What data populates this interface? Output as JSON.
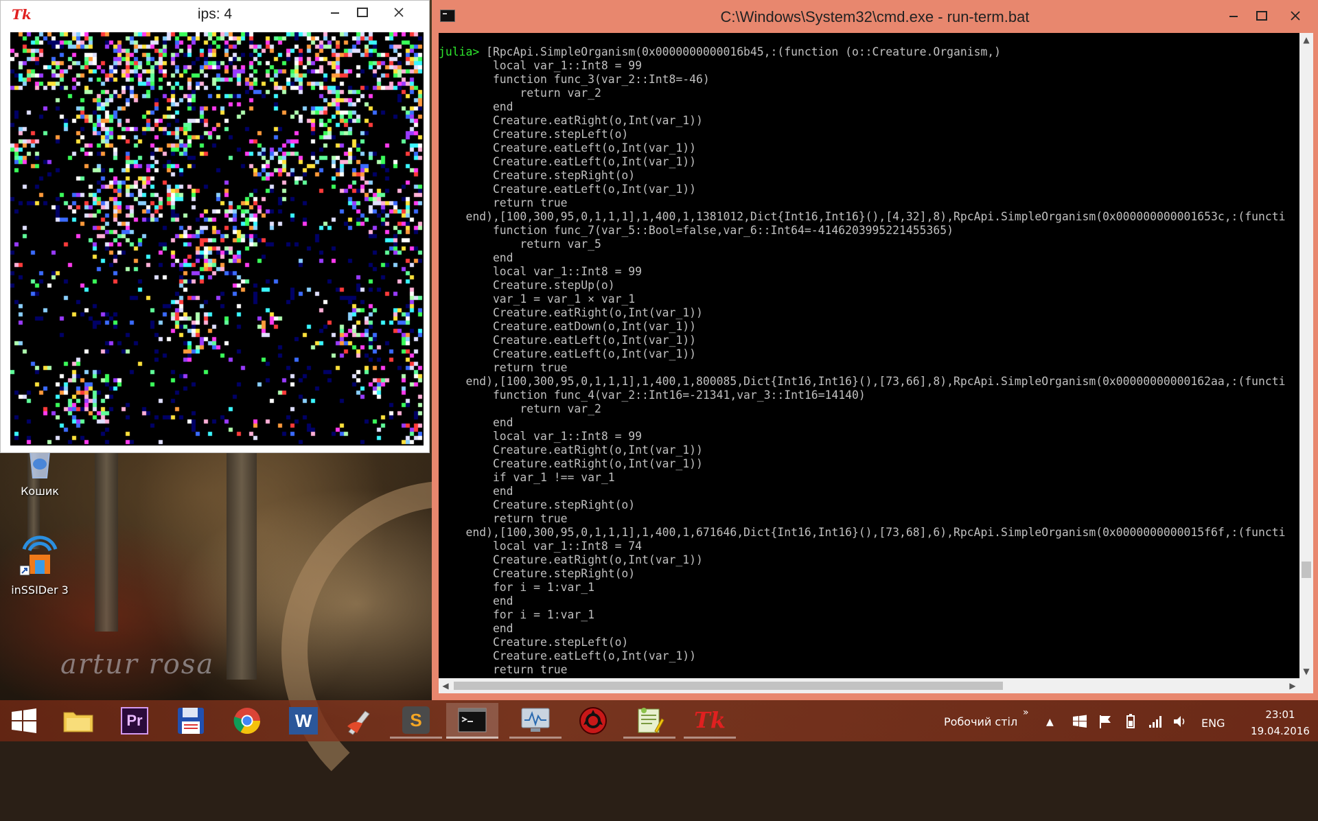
{
  "tk_window": {
    "logo_text": "Tk",
    "title": "ips: 4"
  },
  "cmd_window": {
    "title": "C:\\Windows\\System32\\cmd.exe - run-term.bat",
    "prompt": "julia> ",
    "lines": [
      "[RpcApi.SimpleOrganism(0x0000000000016b45,:(function (o::Creature.Organism,)",
      "        local var_1::Int8 = 99",
      "        function func_3(var_2::Int8=-46)",
      "            return var_2",
      "        end",
      "        Creature.eatRight(o,Int(var_1))",
      "        Creature.stepLeft(o)",
      "        Creature.eatLeft(o,Int(var_1))",
      "        Creature.eatLeft(o,Int(var_1))",
      "        Creature.stepRight(o)",
      "        Creature.eatLeft(o,Int(var_1))",
      "        return true",
      "    end),[100,300,95,0,1,1,1],1,400,1,1381012,Dict{Int16,Int16}(),[4,32],8),RpcApi.SimpleOrganism(0x000000000001653c,:(functi",
      "        function func_7(var_5::Bool=false,var_6::Int64=-4146203995221455365)",
      "            return var_5",
      "        end",
      "        local var_1::Int8 = 99",
      "        Creature.stepUp(o)",
      "        var_1 = var_1 × var_1",
      "        Creature.eatRight(o,Int(var_1))",
      "        Creature.eatDown(o,Int(var_1))",
      "        Creature.eatLeft(o,Int(var_1))",
      "        Creature.eatLeft(o,Int(var_1))",
      "        return true",
      "    end),[100,300,95,0,1,1,1],1,400,1,800085,Dict{Int16,Int16}(),[73,66],8),RpcApi.SimpleOrganism(0x00000000000162aa,:(functi",
      "        function func_4(var_2::Int16=-21341,var_3::Int16=14140)",
      "            return var_2",
      "        end",
      "        local var_1::Int8 = 99",
      "        Creature.eatRight(o,Int(var_1))",
      "        Creature.eatRight(o,Int(var_1))",
      "        if var_1 !== var_1",
      "        end",
      "        Creature.stepRight(o)",
      "        return true",
      "    end),[100,300,95,0,1,1,1],1,400,1,671646,Dict{Int16,Int16}(),[73,68],6),RpcApi.SimpleOrganism(0x0000000000015f6f,:(functi",
      "        local var_1::Int8 = 74",
      "        Creature.eatRight(o,Int(var_1))",
      "        Creature.stepRight(o)",
      "        for i = 1:var_1",
      "        end",
      "        for i = 1:var_1",
      "        end",
      "        Creature.stepLeft(o)",
      "        Creature.eatLeft(o,Int(var_1))",
      "        return true"
    ]
  },
  "desktop": {
    "icons": [
      {
        "label": "Кошик",
        "icon": "recycle-bin-icon"
      },
      {
        "label": "inSSIDer 3",
        "icon": "inssider-icon"
      }
    ],
    "wallpaper_signature": "artur rosa"
  },
  "taskbar": {
    "apps": [
      {
        "name": "windows-start",
        "icon": "windows-logo-icon"
      },
      {
        "name": "file-explorer",
        "icon": "folder-icon"
      },
      {
        "name": "premiere",
        "icon": "premiere-icon",
        "label": "Pr"
      },
      {
        "name": "save-app",
        "icon": "floppy-disk-icon"
      },
      {
        "name": "chrome",
        "icon": "chrome-icon"
      },
      {
        "name": "word",
        "icon": "word-icon",
        "label": "W"
      },
      {
        "name": "ccleaner",
        "icon": "ccleaner-icon"
      },
      {
        "name": "sublime",
        "icon": "sublime-icon",
        "label": "S"
      },
      {
        "name": "cmd",
        "icon": "terminal-icon"
      },
      {
        "name": "monitor",
        "icon": "monitor-icon"
      },
      {
        "name": "app-red",
        "icon": "red-circle-app-icon"
      },
      {
        "name": "notepadpp",
        "icon": "notepad-icon"
      },
      {
        "name": "tk",
        "icon": "tk-icon",
        "label": "Tk"
      }
    ],
    "desktop_label": "Робочий стіл",
    "chevron": "»",
    "language": "ENG",
    "time": "23:01",
    "date": "19.04.2016"
  },
  "colors": {
    "cmd_frame": "#e8876e",
    "prompt_green": "#2ee82e",
    "console_text": "#c0c0c0"
  }
}
